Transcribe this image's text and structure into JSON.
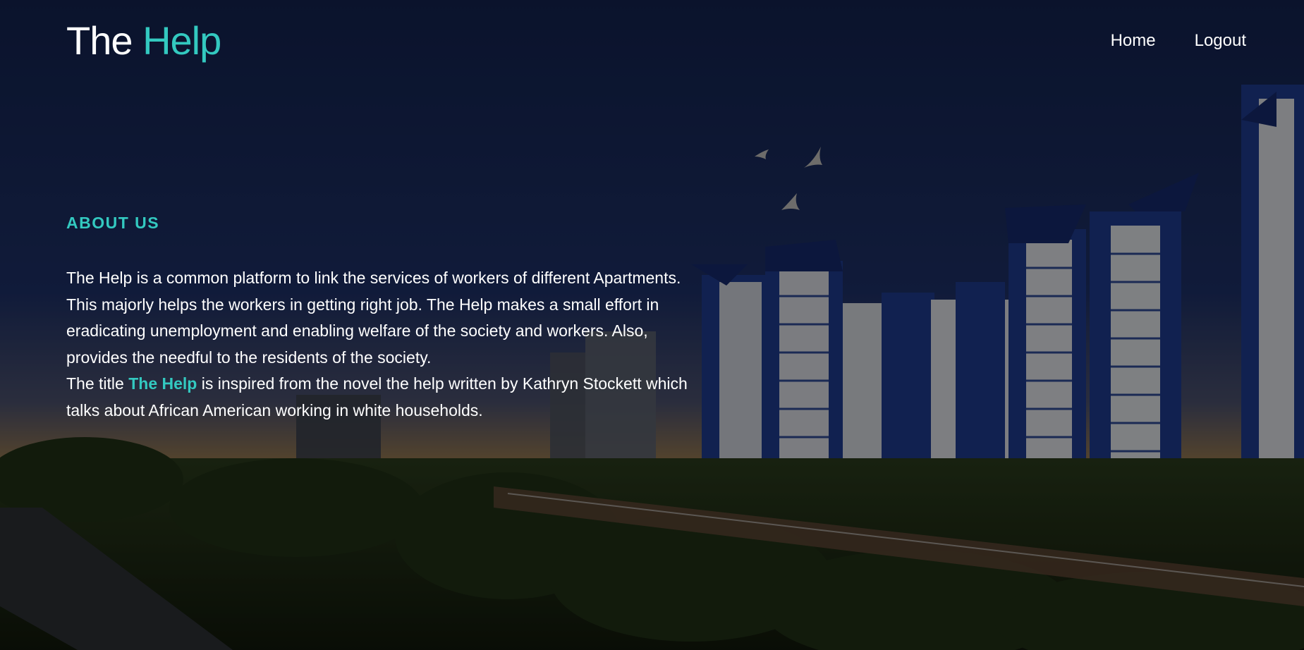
{
  "header": {
    "logo_part1": "The",
    "logo_part2": "Help",
    "nav": {
      "home": "Home",
      "logout": "Logout"
    }
  },
  "about": {
    "heading": "ABOUT US",
    "paragraph1": "The Help is a common platform to link the services of workers of different Apartments. This majorly helps the workers in getting right job. The Help makes a small effort in eradicating unemployment and enabling welfare of the society and workers. Also, provides the needful to the residents of the society.",
    "paragraph2_prefix": "The title",
    "paragraph2_brand": "The Help",
    "paragraph2_suffix": "is inspired from the novel the help written by Kathryn Stockett which talks about African American working in white households."
  },
  "colors": {
    "accent": "#33c9c0",
    "text": "#ffffff",
    "sky_top": "#0f1f45",
    "building_blue": "#1e3a8a"
  },
  "background": {
    "description_icons": [
      "apartment-buildings",
      "birds",
      "trees",
      "road"
    ]
  }
}
